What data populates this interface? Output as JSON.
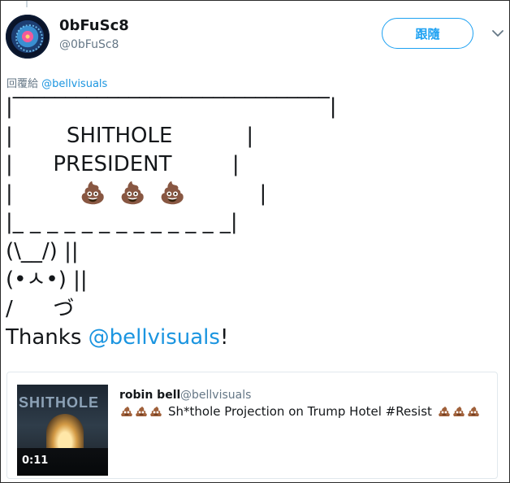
{
  "header": {
    "display_name": "0bFuSc8",
    "handle": "@0bFuSc8",
    "follow_label": "跟隨"
  },
  "reply": {
    "prefix": "回覆給",
    "mention": "@bellvisuals"
  },
  "tweet": {
    "body": "|‾‾‾‾‾‾‾‾‾‾‾‾‾‾‾‾‾‾‾‾‾‾‾‾‾‾‾‾‾‾|\n|        SHITHOLE           |\n|      PRESIDENT         |\n|          💩  💩  💩           |\n|_ _ _ _ _ _ _ _ _ _ _ _ _|\n(\\__/) ||\n(•ㅅ•) ||\n/      づ",
    "thanks_prefix": "Thanks ",
    "thanks_mention": "@bellvisuals",
    "thanks_suffix": "!"
  },
  "quote": {
    "name": "robin bell",
    "handle": "@bellvisuals",
    "text": "Sh*thole Projection on Trump Hotel #Resist",
    "duration": "0:11",
    "thumb_sign": "SHITHOLE"
  },
  "icons": {
    "chevron": "chevron-down-icon",
    "poo": "pile-of-poo-icon"
  },
  "colors": {
    "accent": "#1da1f2",
    "link": "#1b95e0",
    "muted": "#657786",
    "text": "#14171a"
  }
}
